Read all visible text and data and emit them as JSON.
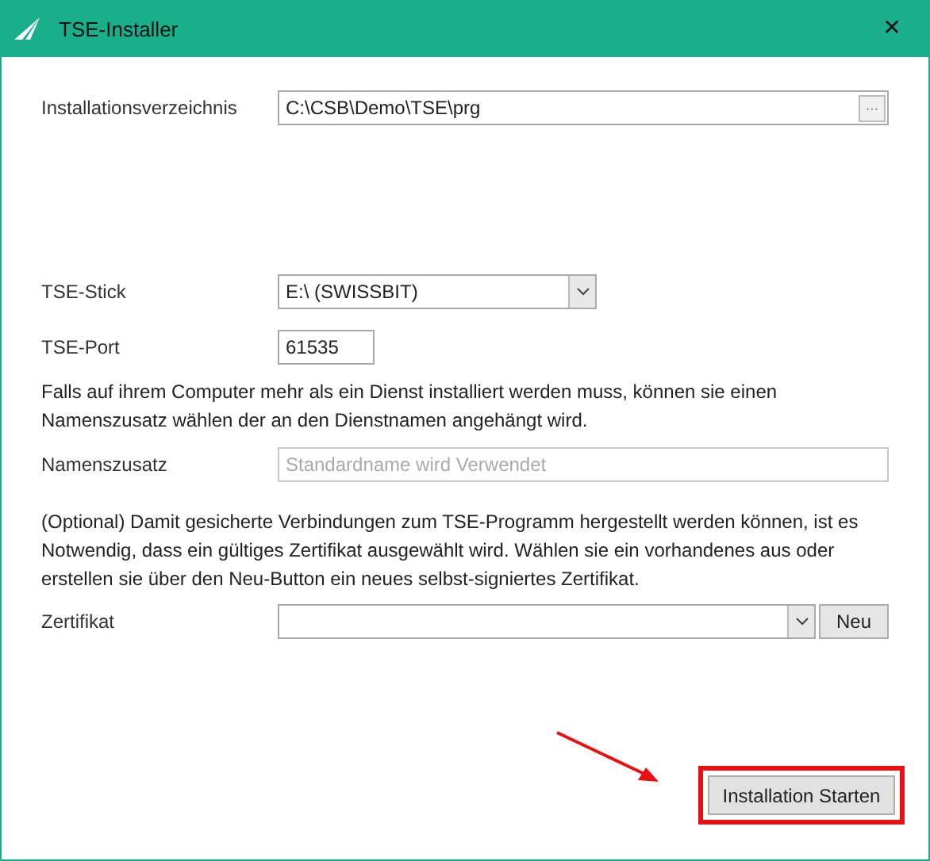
{
  "window": {
    "title": "TSE-Installer",
    "close": "✕"
  },
  "install_dir": {
    "label": "Installationsverzeichnis",
    "value": "C:\\CSB\\Demo\\TSE\\prg",
    "browse": "···"
  },
  "tse_stick": {
    "label": "TSE-Stick",
    "value": "E:\\ (SWISSBIT)"
  },
  "tse_port": {
    "label": "TSE-Port",
    "value": "61535"
  },
  "name_info": "Falls auf ihrem Computer mehr als ein Dienst installiert werden muss, können sie einen Namenszusatz wählen der an den Dienstnamen angehängt wird.",
  "name_suffix": {
    "label": "Namenszusatz",
    "placeholder": "Standardname wird Verwendet"
  },
  "cert_info": "(Optional) Damit gesicherte Verbindungen zum TSE-Programm hergestellt werden können, ist es Notwendig, dass ein gültiges Zertifikat ausgewählt wird. Wählen sie ein vorhandenes aus oder erstellen sie über den Neu-Button ein neues selbst-signiertes Zertifikat.",
  "certificate": {
    "label": "Zertifikat",
    "new_button": "Neu"
  },
  "start_button": {
    "label": "Installation Starten",
    "highlighted": true
  }
}
